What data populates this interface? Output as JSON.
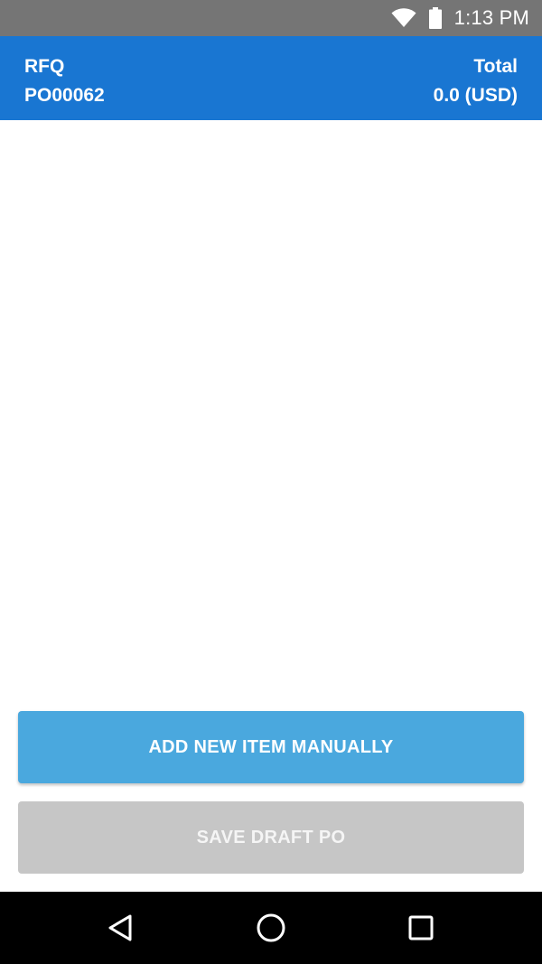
{
  "status_bar": {
    "time": "1:13 PM",
    "icons": [
      "wifi-icon",
      "battery-icon"
    ]
  },
  "header": {
    "left_label": "RFQ",
    "left_value": "PO00062",
    "right_label": "Total",
    "right_value": "0.0 (USD)"
  },
  "actions": {
    "add_item_label": "ADD NEW ITEM MANUALLY",
    "save_draft_label": "SAVE DRAFT PO"
  },
  "nav_bar": {
    "icons": [
      "back-icon",
      "home-icon",
      "recents-icon"
    ]
  },
  "colors": {
    "status_bar": "#757575",
    "header": "#1976d2",
    "primary_button": "#4aa8de",
    "disabled_button": "#c6c6c6",
    "nav_bar": "#000000"
  }
}
